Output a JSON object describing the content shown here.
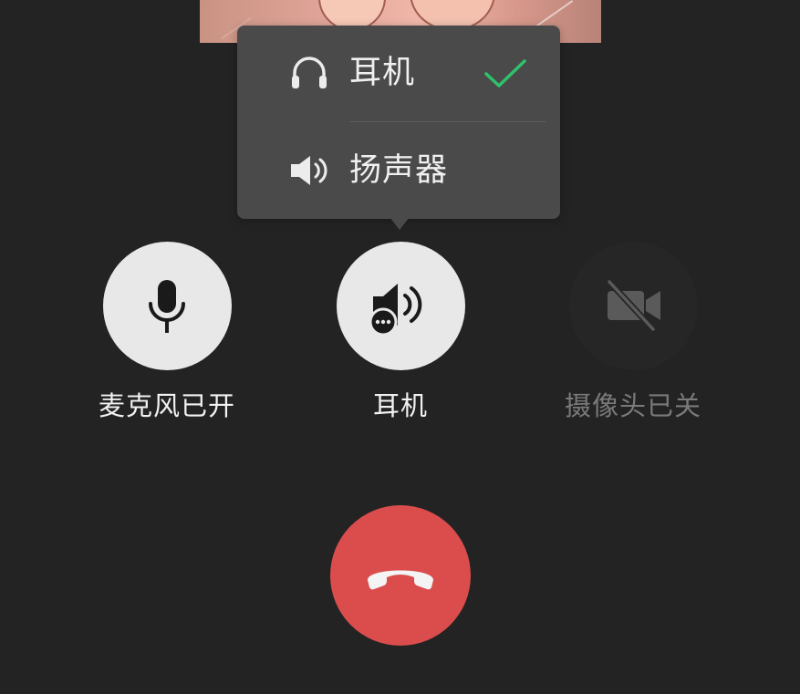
{
  "audio_menu": {
    "items": [
      {
        "label": "耳机",
        "icon": "headphones-icon",
        "selected": true
      },
      {
        "label": "扬声器",
        "icon": "speaker-icon",
        "selected": false
      }
    ],
    "check_color": "#2ec26a"
  },
  "controls": {
    "microphone": {
      "label": "麦克风已开",
      "icon": "microphone-icon",
      "state": "on"
    },
    "audio_output": {
      "label": "耳机",
      "icon": "speaker-more-icon"
    },
    "camera": {
      "label": "摄像头已关",
      "icon": "camera-off-icon",
      "state": "off"
    }
  },
  "hangup": {
    "icon": "hangup-phone-icon",
    "color": "#db4d4d"
  },
  "colors": {
    "background": "#232323",
    "popup": "#4a4a4a",
    "button_light": "#e8e8e8",
    "label_active": "#f2f2f2",
    "label_disabled": "#7a7a7a"
  }
}
